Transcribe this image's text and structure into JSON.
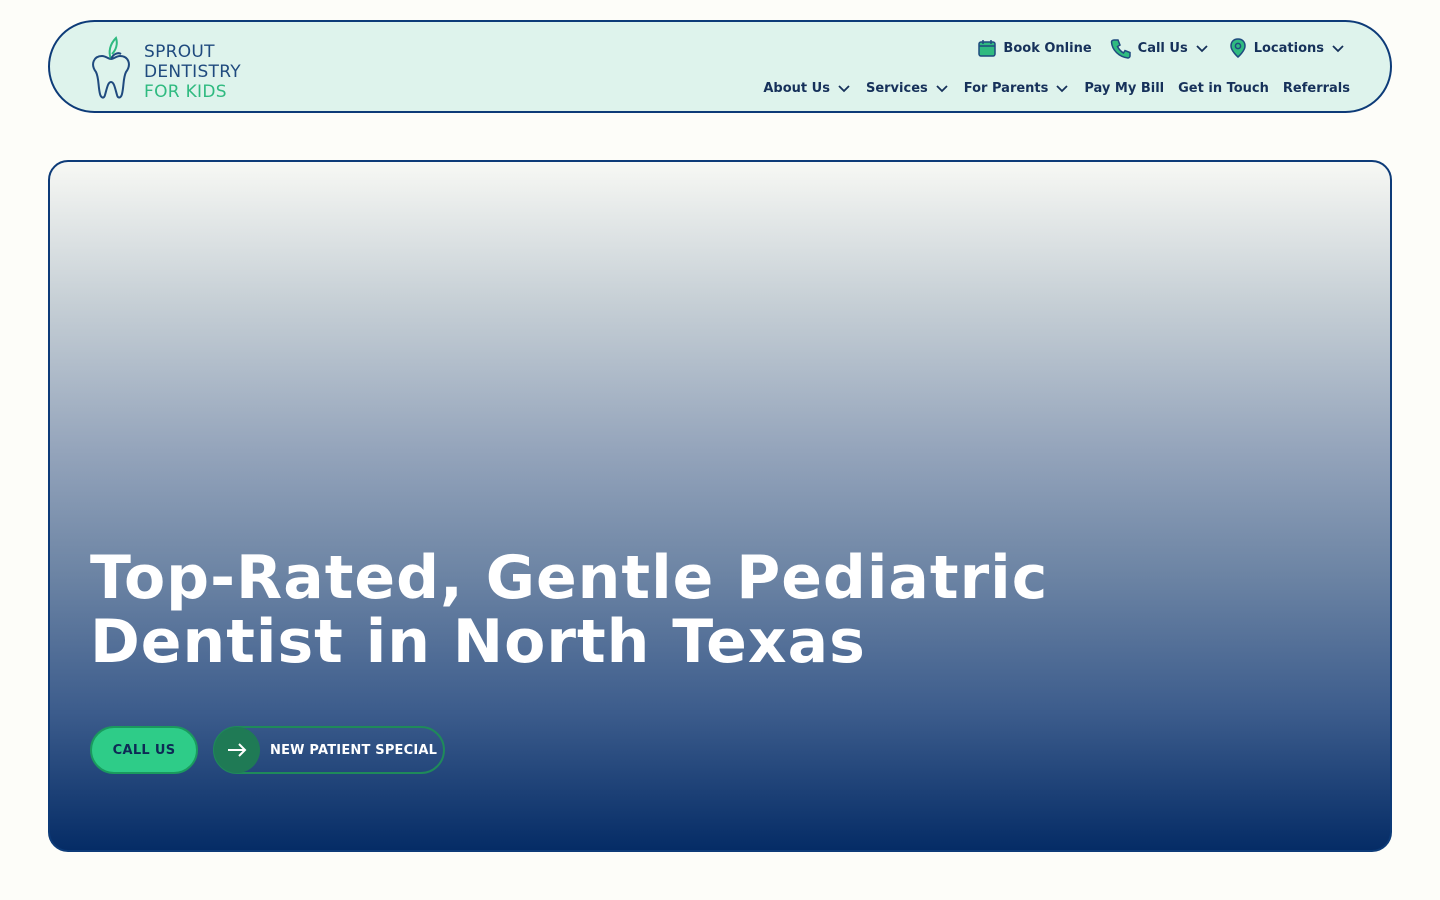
{
  "header": {
    "logo": {
      "line1": "SPROUT",
      "line2": "DENTISTRY",
      "line3": "FOR KIDS"
    },
    "top_nav": [
      {
        "label": "Book Online",
        "icon": "calendar-icon"
      },
      {
        "label": "Call Us",
        "icon": "phone-icon",
        "dropdown": true
      },
      {
        "label": "Locations",
        "icon": "location-pin-icon",
        "dropdown": true
      }
    ],
    "main_nav": [
      {
        "label": "About Us",
        "dropdown": true
      },
      {
        "label": "Services",
        "dropdown": true
      },
      {
        "label": "For Parents",
        "dropdown": true
      },
      {
        "label": "Pay My Bill",
        "dropdown": false
      },
      {
        "label": "Get in Touch",
        "dropdown": false
      },
      {
        "label": "Referrals",
        "dropdown": false
      }
    ]
  },
  "hero": {
    "title_line1": "Top-Rated, Gentle Pediatric",
    "title_line2": "Dentist in North Texas",
    "call_button": "CALL US",
    "special_button": "NEW PATIENT SPECIAL"
  },
  "colors": {
    "brand_navy": "#0d3b78",
    "brand_green": "#2ecc88",
    "header_bg": "#def3ec"
  }
}
